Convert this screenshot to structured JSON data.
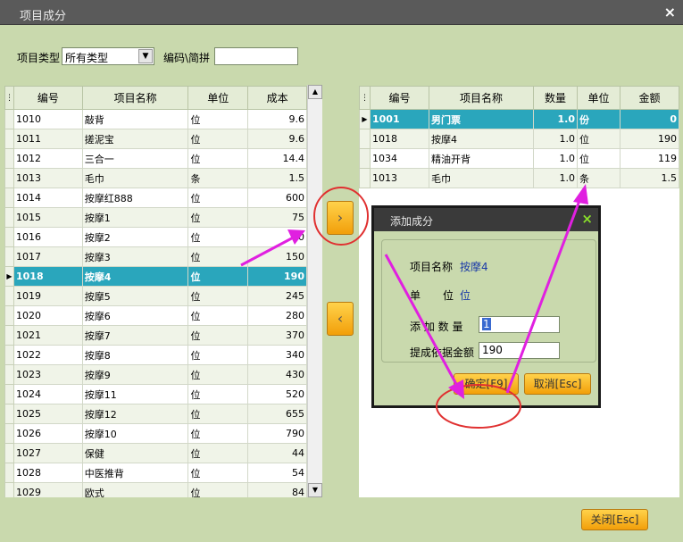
{
  "window": {
    "title": "项目成分",
    "close": "×"
  },
  "filter": {
    "type_label": "项目类型",
    "type_value": "所有类型",
    "code_label": "编码\\简拼",
    "code_value": ""
  },
  "left_table": {
    "headers": [
      "编号",
      "项目名称",
      "单位",
      "成本"
    ],
    "selected_index": 8,
    "rows": [
      [
        "1010",
        "敲背",
        "位",
        "9.6"
      ],
      [
        "1011",
        "搓泥宝",
        "位",
        "9.6"
      ],
      [
        "1012",
        "三合一",
        "位",
        "14.4"
      ],
      [
        "1013",
        "毛巾",
        "条",
        "1.5"
      ],
      [
        "1014",
        "按摩红888",
        "位",
        "600"
      ],
      [
        "1015",
        "按摩1",
        "位",
        "75"
      ],
      [
        "1016",
        "按摩2",
        "位",
        "10"
      ],
      [
        "1017",
        "按摩3",
        "位",
        "150"
      ],
      [
        "1018",
        "按摩4",
        "位",
        "190"
      ],
      [
        "1019",
        "按摩5",
        "位",
        "245"
      ],
      [
        "1020",
        "按摩6",
        "位",
        "280"
      ],
      [
        "1021",
        "按摩7",
        "位",
        "370"
      ],
      [
        "1022",
        "按摩8",
        "位",
        "340"
      ],
      [
        "1023",
        "按摩9",
        "位",
        "430"
      ],
      [
        "1024",
        "按摩11",
        "位",
        "520"
      ],
      [
        "1025",
        "按摩12",
        "位",
        "655"
      ],
      [
        "1026",
        "按摩10",
        "位",
        "790"
      ],
      [
        "1027",
        "保健",
        "位",
        "44"
      ],
      [
        "1028",
        "中医推背",
        "位",
        "54"
      ],
      [
        "1029",
        "欧式",
        "位",
        "84"
      ]
    ]
  },
  "right_table": {
    "headers": [
      "编号",
      "项目名称",
      "数量",
      "单位",
      "金额"
    ],
    "selected_index": 0,
    "rows": [
      [
        "1001",
        "男门票",
        "1.0",
        "份",
        "0"
      ],
      [
        "1018",
        "按摩4",
        "1.0",
        "位",
        "190"
      ],
      [
        "1034",
        "精油开背",
        "1.0",
        "位",
        "119"
      ],
      [
        "1013",
        "毛巾",
        "1.0",
        "条",
        "1.5"
      ]
    ]
  },
  "buttons": {
    "add": "›",
    "remove": "‹",
    "close": "关闭[Esc]"
  },
  "dialog": {
    "title": "添加成分",
    "close": "×",
    "name_label": "项目名称",
    "name_value": "按摩4",
    "unit_label_1": "单",
    "unit_label_2": "位",
    "unit_value": "位",
    "qty_label": "添 加 数 量",
    "qty_value": "1",
    "amount_label": "提成依据金额",
    "amount_value": "190",
    "ok": "确定[F9]",
    "cancel": "取消[Esc]"
  },
  "colors": {
    "accent": "#2aa6bc",
    "background": "#c9d9ad",
    "button": "#f5b21e",
    "annotation": "#e020e0",
    "circle": "#e03030"
  }
}
